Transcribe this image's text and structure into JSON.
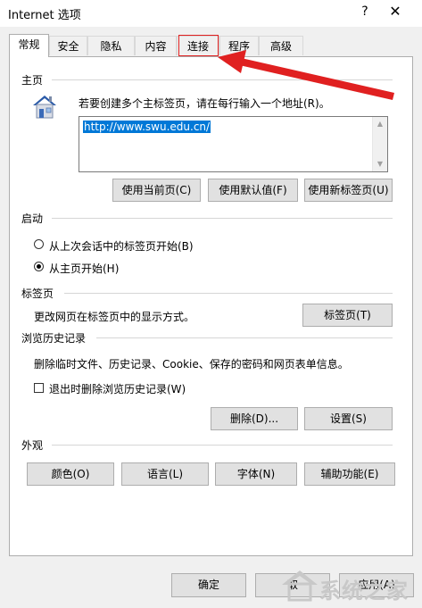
{
  "window": {
    "title": "Internet 选项",
    "help_label": "?",
    "close_label": "✕"
  },
  "tabs": [
    {
      "label": "常规",
      "active": true
    },
    {
      "label": "安全"
    },
    {
      "label": "隐私"
    },
    {
      "label": "内容"
    },
    {
      "label": "连接",
      "highlighted": true
    },
    {
      "label": "程序"
    },
    {
      "label": "高级"
    }
  ],
  "homepage": {
    "title": "主页",
    "icon": "house-icon",
    "instruction": "若要创建多个主标签页，请在每行输入一个地址(R)。",
    "url": "http://www.swu.edu.cn/",
    "buttons": {
      "current": "使用当前页(C)",
      "default": "使用默认值(F)",
      "newtab": "使用新标签页(U)"
    }
  },
  "startup": {
    "title": "启动",
    "options": [
      {
        "label": "从上次会话中的标签页开始(B)",
        "selected": false
      },
      {
        "label": "从主页开始(H)",
        "selected": true
      }
    ]
  },
  "tabs_section": {
    "title": "标签页",
    "description": "更改网页在标签页中的显示方式。",
    "button": "标签页(T)"
  },
  "history": {
    "title": "浏览历史记录",
    "description": "删除临时文件、历史记录、Cookie、保存的密码和网页表单信息。",
    "checkbox_label": "退出时删除浏览历史记录(W)",
    "checkbox_checked": false,
    "delete_button": "删除(D)...",
    "settings_button": "设置(S)"
  },
  "appearance": {
    "title": "外观",
    "buttons": {
      "colors": "颜色(O)",
      "languages": "语言(L)",
      "fonts": "字体(N)",
      "accessibility": "辅助功能(E)"
    }
  },
  "footer": {
    "ok": "确定",
    "cancel": "取",
    "apply": "应用(A)"
  },
  "watermark": {
    "text": "系统之家"
  },
  "colors": {
    "highlight": "#e02020",
    "selection": "#0078d7"
  }
}
